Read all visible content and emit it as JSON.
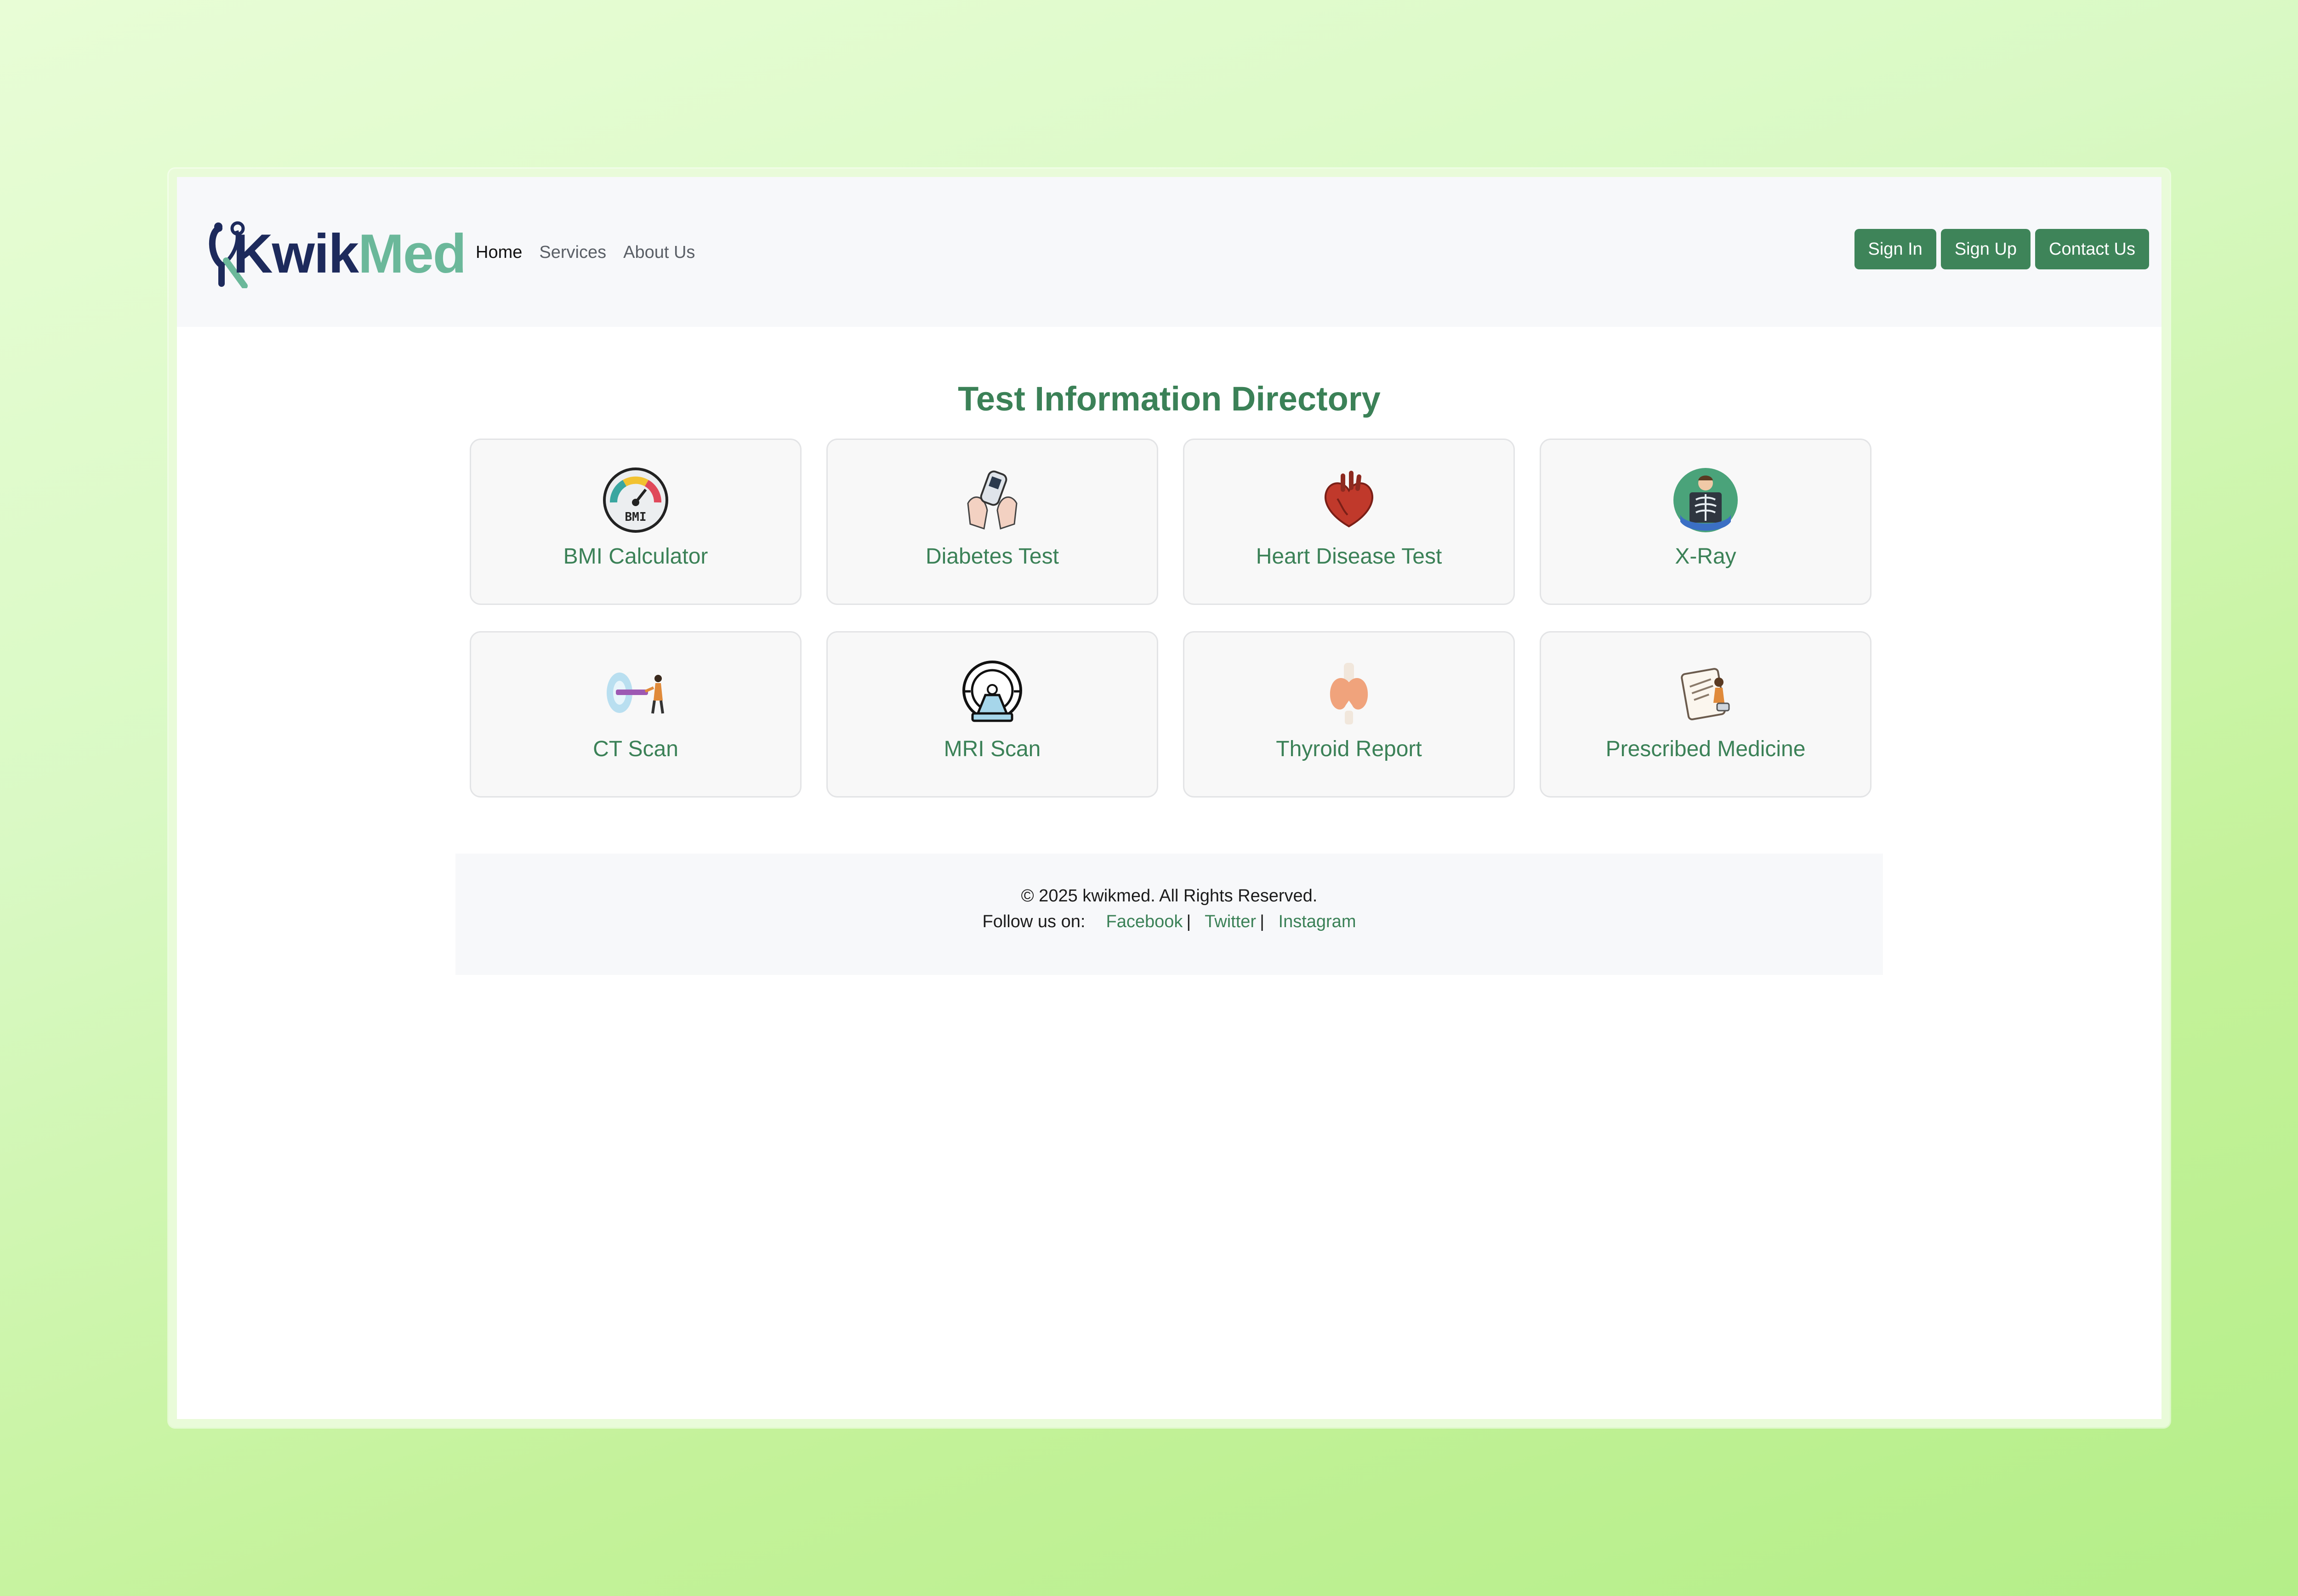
{
  "brand": {
    "logo_kwik": "Kwik",
    "logo_med": "Med"
  },
  "nav": {
    "links": [
      {
        "label": "Home",
        "active": true
      },
      {
        "label": "Services",
        "active": false
      },
      {
        "label": "About Us",
        "active": false
      }
    ],
    "buttons": {
      "sign_in": "Sign In",
      "sign_up": "Sign Up",
      "contact": "Contact Us"
    }
  },
  "main": {
    "title": "Test Information Directory",
    "cards": [
      {
        "label": "BMI Calculator",
        "icon": "bmi-gauge-icon"
      },
      {
        "label": "Diabetes Test",
        "icon": "glucometer-icon"
      },
      {
        "label": "Heart Disease Test",
        "icon": "heart-icon"
      },
      {
        "label": "X-Ray",
        "icon": "xray-icon"
      },
      {
        "label": "CT Scan",
        "icon": "ct-scanner-icon"
      },
      {
        "label": "MRI Scan",
        "icon": "mri-machine-icon"
      },
      {
        "label": "Thyroid Report",
        "icon": "thyroid-icon"
      },
      {
        "label": "Prescribed Medicine",
        "icon": "prescription-icon"
      }
    ]
  },
  "footer": {
    "copyright": "© 2025 kwikmed. All Rights Reserved.",
    "follow_label": "Follow us on:",
    "links": [
      "Facebook",
      "Twitter",
      "Instagram"
    ]
  },
  "colors": {
    "brand_green": "#3e8459",
    "title_green": "#3b8157",
    "logo_navy": "#1d2a5c",
    "logo_teal": "#6bb89a"
  }
}
